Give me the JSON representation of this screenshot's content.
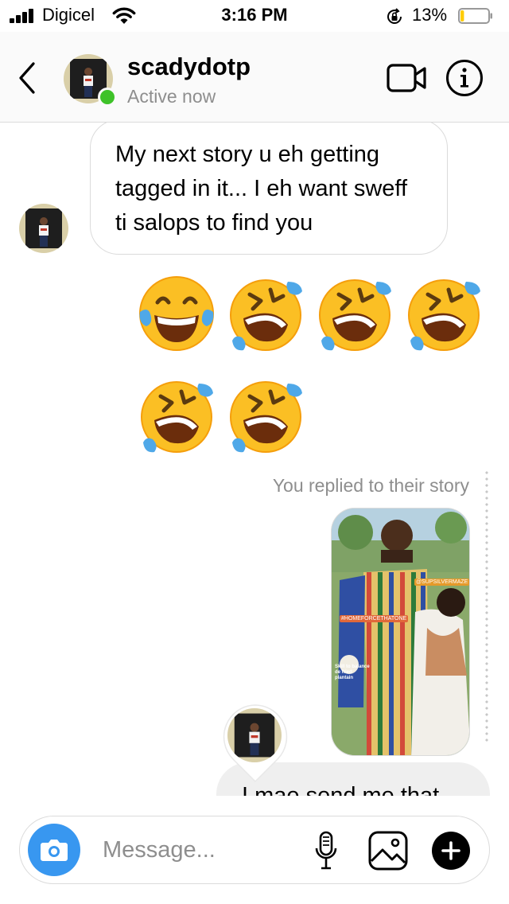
{
  "status_bar": {
    "carrier": "Digicel",
    "time": "3:16 PM",
    "battery_percent": "13%",
    "battery_level": 0.13,
    "icons": [
      "signal-icon",
      "wifi-icon",
      "orientation-lock-icon",
      "battery-icon"
    ]
  },
  "header": {
    "username": "scadydotp",
    "status": "Active now",
    "icons": [
      "back-icon",
      "video-call-icon",
      "info-icon"
    ]
  },
  "conversation": {
    "incoming_message": "My next story u eh getting tagged in it... I eh want sweff ti salops to find you",
    "emoji_message": [
      "😂",
      "🤣",
      "🤣",
      "🤣",
      "🤣",
      "🤣"
    ],
    "story_reply_label": "You replied to their story",
    "story": {
      "tag_1": "@SUPSILVERMAZE",
      "tag_2": "#HOMEFORCETHATONE",
      "caption": "Skill to balance de fried plantain"
    },
    "reply_text": "I mae send me that"
  },
  "composer": {
    "placeholder": "Message...",
    "icons": [
      "camera-icon",
      "mic-icon",
      "gallery-icon",
      "plus-icon"
    ]
  },
  "colors": {
    "accent_blue": "#3897f0",
    "online_green": "#3ec229",
    "battery_yellow": "#ffcc00",
    "secondary_text": "#8e8e8e"
  }
}
